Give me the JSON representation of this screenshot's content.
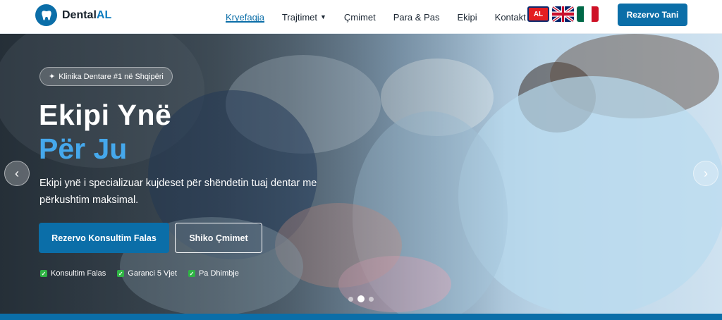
{
  "brand": {
    "name_main": "Dental",
    "name_accent": "AL",
    "accent_color": "#0b7bbf"
  },
  "nav": {
    "items": [
      {
        "label": "Kryefaqja",
        "active": true
      },
      {
        "label": "Trajtimet",
        "has_dropdown": true
      },
      {
        "label": "Çmimet"
      },
      {
        "label": "Para & Pas"
      },
      {
        "label": "Ekipi"
      },
      {
        "label": "Kontakt"
      }
    ],
    "dropdown_caret": "▼"
  },
  "languages": {
    "al_label": "AL",
    "flags": [
      "albania-flag-icon",
      "uk-flag-icon",
      "mexico-flag-icon"
    ]
  },
  "header_cta": {
    "label": "Rezervo Tani"
  },
  "hero": {
    "badge": "Klinika Dentare #1 në Shqipëri",
    "badge_icon": "✦",
    "title_line1": "Ekipi Ynë",
    "title_line2": "Për Ju",
    "description": "Ekipi ynë i specializuar kujdeset për shëndetin tuaj dentar me përkushtim maksimal.",
    "primary_button": "Rezervo Konsultim Falas",
    "secondary_button": "Shiko Çmimet",
    "features": [
      "Konsultim Falas",
      "Garanci 5 Vjet",
      "Pa Dhimbje"
    ],
    "check_glyph": "✓",
    "arrow_left": "‹",
    "arrow_right": "›",
    "active_slide": 2,
    "slide_count": 3
  },
  "colors": {
    "primary": "#0b6ea8",
    "highlight": "#45a8ec",
    "check": "#2fb344"
  }
}
